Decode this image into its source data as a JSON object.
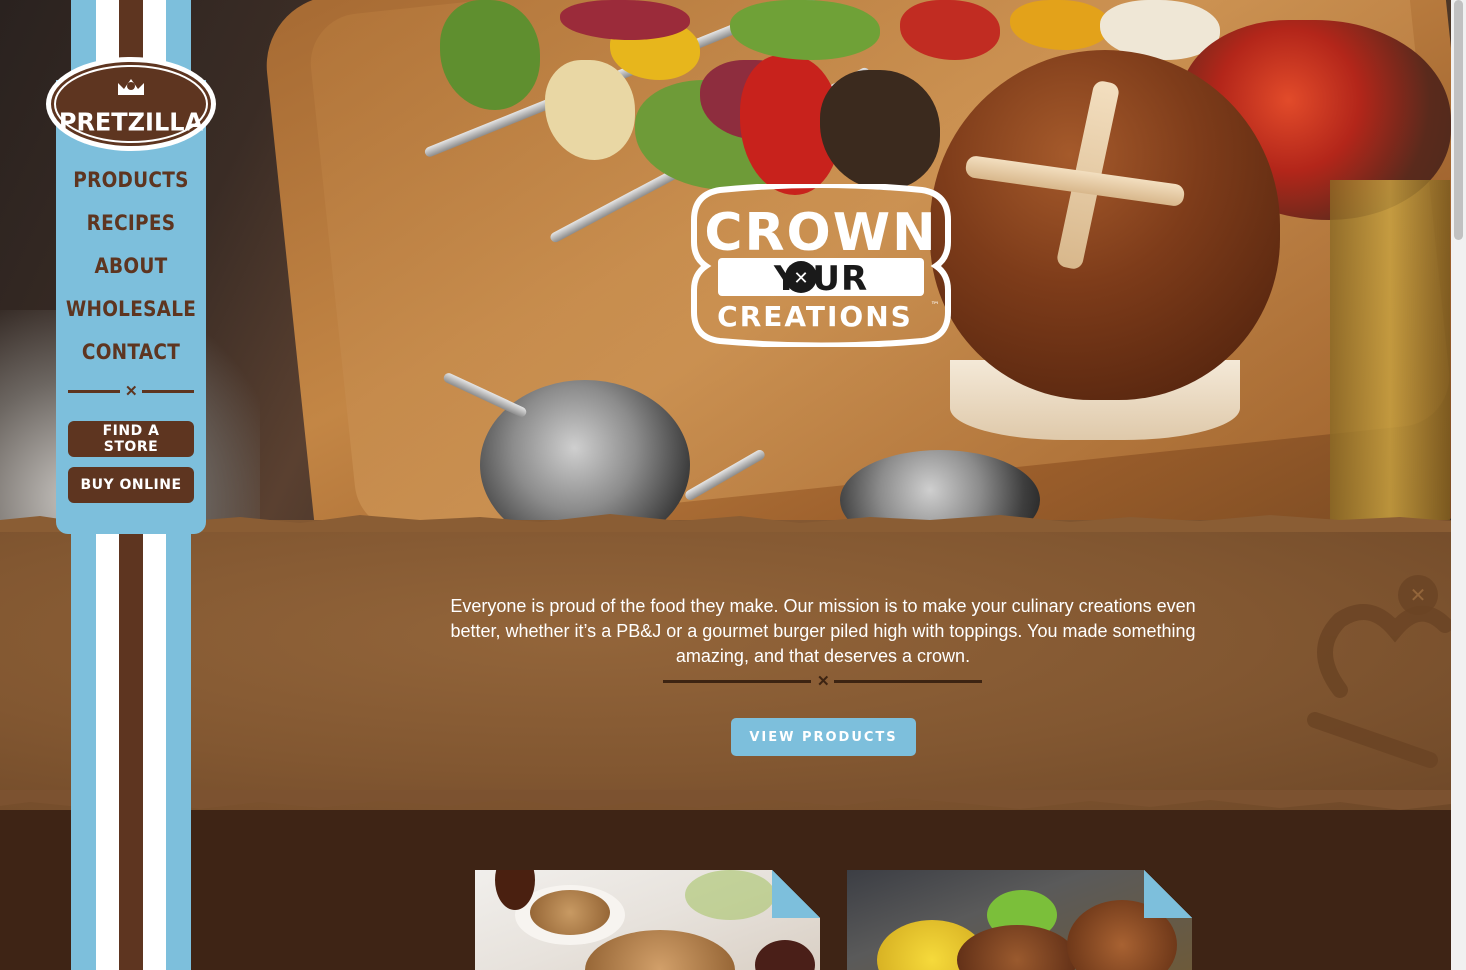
{
  "brand": {
    "logo_text": "PRETZILLA",
    "icon": "crown-icon"
  },
  "nav": {
    "items": [
      {
        "label": "PRODUCTS"
      },
      {
        "label": "RECIPES"
      },
      {
        "label": "ABOUT"
      },
      {
        "label": "WHOLESALE"
      },
      {
        "label": "CONTACT"
      }
    ],
    "find_store": "FIND A STORE",
    "buy_online": "BUY ONLINE"
  },
  "hero": {
    "badge_line1": "CROWN",
    "badge_line2": "Y  UR",
    "badge_line3": "CREATIONS",
    "badge_tm": "™"
  },
  "mission": {
    "text": "Everyone is proud of the food they make. Our mission is to make your culinary creations even better, whether it’s a PB&J or a gourmet burger piled high with toppings. You made something amazing, and that deserves a crown.",
    "cta": "VIEW PRODUCTS"
  },
  "colors": {
    "brown_dark": "#3e2415",
    "brand_brown": "#5e3520",
    "kraft": "#825731",
    "sky_blue": "#7dbfdc"
  }
}
